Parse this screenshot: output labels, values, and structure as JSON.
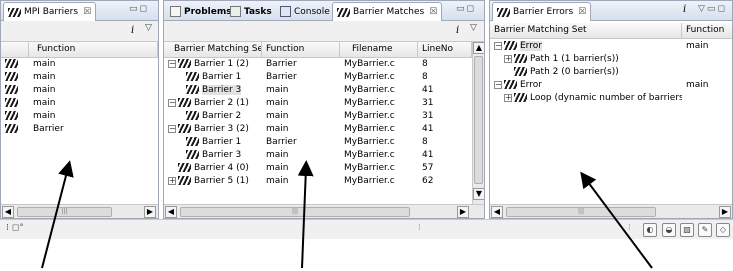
{
  "mpi_barriers": {
    "tab_label": "MPI Barriers",
    "column_function": "Function",
    "rows": [
      "main",
      "main",
      "main",
      "main",
      "main",
      "Barrier"
    ]
  },
  "middle": {
    "tabs": [
      "Problems",
      "Tasks",
      "Console",
      "Barrier Matches"
    ],
    "columns": [
      "Barrier Matching Set",
      "Function",
      "Filename",
      "LineNo"
    ],
    "rows": [
      {
        "set": "Barrier 1 (2)",
        "function": "Barrier",
        "filename": "MyBarrier.c",
        "line": "8"
      },
      {
        "set": "Barrier 1",
        "function": "Barrier",
        "filename": "MyBarrier.c",
        "line": "8"
      },
      {
        "set": "Barrier 3",
        "function": "main",
        "filename": "MyBarrier.c",
        "line": "41"
      },
      {
        "set": "Barrier 2 (1)",
        "function": "main",
        "filename": "MyBarrier.c",
        "line": "31"
      },
      {
        "set": "Barrier 2",
        "function": "main",
        "filename": "MyBarrier.c",
        "line": "31"
      },
      {
        "set": "Barrier 3 (2)",
        "function": "main",
        "filename": "MyBarrier.c",
        "line": "41"
      },
      {
        "set": "Barrier 1",
        "function": "Barrier",
        "filename": "MyBarrier.c",
        "line": "8"
      },
      {
        "set": "Barrier 3",
        "function": "main",
        "filename": "MyBarrier.c",
        "line": "41"
      },
      {
        "set": "Barrier 4 (0)",
        "function": "main",
        "filename": "MyBarrier.c",
        "line": "57"
      },
      {
        "set": "Barrier 5 (1)",
        "function": "main",
        "filename": "MyBarrier.c",
        "line": "62"
      }
    ]
  },
  "barrier_errors": {
    "tab_label": "Barrier Errors",
    "columns": [
      "Barrier Matching Set",
      "Function"
    ],
    "rows": [
      {
        "label": "Error",
        "function": "main"
      },
      {
        "label": "Path 1 (1 barrier(s))",
        "function": ""
      },
      {
        "label": "Path 2 (0 barrier(s))",
        "function": ""
      },
      {
        "label": "Error",
        "function": "main"
      },
      {
        "label": "Loop (dynamic number of barriers)",
        "function": ""
      }
    ]
  },
  "toolbar": {
    "info_glyph": "i"
  },
  "colors": {
    "accent": "#a0a8b8",
    "tab_bg": "#d6e0ee"
  },
  "icons": [
    "mpi-icon",
    "close-icon",
    "minimize-icon",
    "maximize-icon",
    "info-icon",
    "view-menu-icon"
  ]
}
